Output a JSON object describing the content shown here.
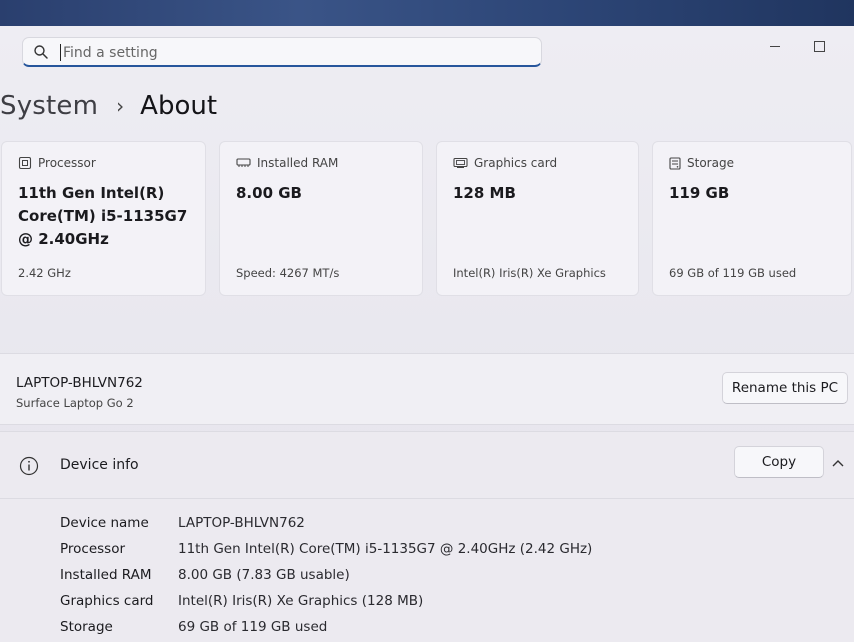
{
  "search": {
    "placeholder": "Find a setting"
  },
  "breadcrumb": {
    "parent": "System",
    "separator": "›",
    "current": "About"
  },
  "cards": [
    {
      "icon": "processor-icon",
      "title": "Processor",
      "value": "11th Gen Intel(R) Core(TM) i5-1135G7 @ 2.40GHz",
      "sub": "2.42 GHz"
    },
    {
      "icon": "memory-icon",
      "title": "Installed RAM",
      "value": "8.00 GB",
      "sub": "Speed: 4267 MT/s"
    },
    {
      "icon": "graphics-card-icon",
      "title": "Graphics card",
      "value": "128 MB",
      "sub": "Intel(R) Iris(R) Xe Graphics"
    },
    {
      "icon": "storage-icon",
      "title": "Storage",
      "value": "119 GB",
      "sub": "69 GB of 119 GB used"
    }
  ],
  "pc": {
    "name": "LAPTOP-BHLVN762",
    "model": "Surface Laptop Go 2",
    "rename_label": "Rename this PC"
  },
  "device_info": {
    "title": "Device info",
    "copy_label": "Copy",
    "rows": [
      {
        "label": "Device name",
        "value": "LAPTOP-BHLVN762"
      },
      {
        "label": "Processor",
        "value": "11th Gen Intel(R) Core(TM) i5-1135G7 @ 2.40GHz (2.42 GHz)"
      },
      {
        "label": "Installed RAM",
        "value": "8.00 GB (7.83 GB usable)"
      },
      {
        "label": "Graphics card",
        "value": "Intel(R) Iris(R) Xe Graphics (128 MB)"
      },
      {
        "label": "Storage",
        "value": "69 GB of 119 GB used"
      }
    ]
  }
}
